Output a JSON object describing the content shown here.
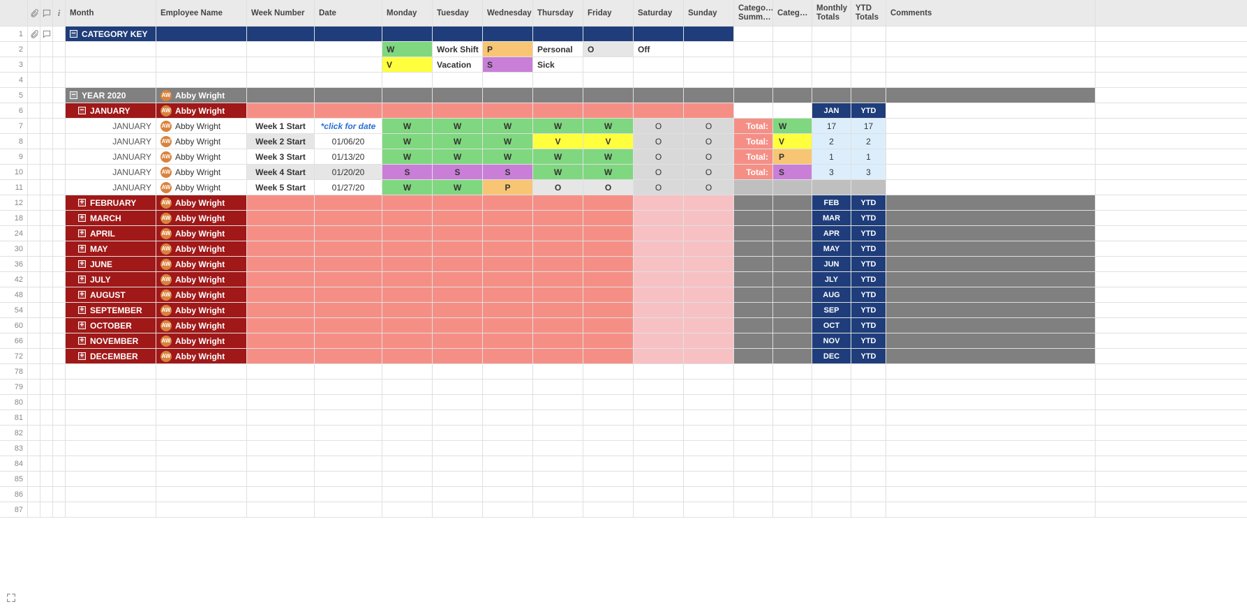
{
  "headers": {
    "month": "Month",
    "employee": "Employee Name",
    "weeknum": "Week Number",
    "date": "Date",
    "days": [
      "Monday",
      "Tuesday",
      "Wednesday",
      "Thursday",
      "Friday",
      "Saturday",
      "Sunday"
    ],
    "catsum": "Catego… Summ…",
    "cat": "Categ…",
    "monthtot": "Monthly Totals",
    "ytdtot": "YTD Totals",
    "comments": "Comments"
  },
  "categoryKey": {
    "title": "CATEGORY KEY",
    "rows": [
      [
        {
          "code": "W",
          "bg": "green"
        },
        {
          "label": "Work Shift"
        },
        {
          "code": "P",
          "bg": "orange"
        },
        {
          "label": "Personal"
        },
        {
          "code": "O",
          "bg": "lightgray"
        },
        {
          "label": "Off"
        }
      ],
      [
        {
          "code": "V",
          "bg": "yellow"
        },
        {
          "label": "Vacation"
        },
        {
          "code": "S",
          "bg": "purple"
        },
        {
          "label": "Sick"
        }
      ]
    ]
  },
  "yearTitle": "YEAR 2020",
  "employee": {
    "name": "Abby Wright",
    "initials": "AW"
  },
  "january": {
    "title": "JANUARY",
    "monthCode": "JAN",
    "ytd": "YTD",
    "weeks": [
      {
        "rn": "7",
        "name": "Week 1 Start",
        "date": "*click for date",
        "dateClass": "italic-blue",
        "d": [
          {
            "v": "W",
            "bg": "green"
          },
          {
            "v": "W",
            "bg": "green"
          },
          {
            "v": "W",
            "bg": "green"
          },
          {
            "v": "W",
            "bg": "green"
          },
          {
            "v": "W",
            "bg": "green"
          },
          {
            "v": "O",
            "bg": "offgray"
          },
          {
            "v": "O",
            "bg": "offgray"
          }
        ],
        "totLbl": "Total:",
        "catCode": {
          "v": "W",
          "bg": "green"
        },
        "m": "17",
        "y": "17"
      },
      {
        "rn": "8",
        "name": "Week 2 Start",
        "nameBg": "lightgray",
        "date": "01/06/20",
        "d": [
          {
            "v": "W",
            "bg": "green"
          },
          {
            "v": "W",
            "bg": "green"
          },
          {
            "v": "W",
            "bg": "green"
          },
          {
            "v": "V",
            "bg": "yellow"
          },
          {
            "v": "V",
            "bg": "yellow"
          },
          {
            "v": "O",
            "bg": "offgray"
          },
          {
            "v": "O",
            "bg": "offgray"
          }
        ],
        "totLbl": "Total:",
        "catCode": {
          "v": "V",
          "bg": "yellow"
        },
        "m": "2",
        "y": "2"
      },
      {
        "rn": "9",
        "name": "Week 3 Start",
        "date": "01/13/20",
        "d": [
          {
            "v": "W",
            "bg": "green"
          },
          {
            "v": "W",
            "bg": "green"
          },
          {
            "v": "W",
            "bg": "green"
          },
          {
            "v": "W",
            "bg": "green"
          },
          {
            "v": "W",
            "bg": "green"
          },
          {
            "v": "O",
            "bg": "offgray"
          },
          {
            "v": "O",
            "bg": "offgray"
          }
        ],
        "totLbl": "Total:",
        "catCode": {
          "v": "P",
          "bg": "orange"
        },
        "m": "1",
        "y": "1"
      },
      {
        "rn": "10",
        "name": "Week 4 Start",
        "nameBg": "lightgray",
        "date": "01/20/20",
        "dateBg": "lightgray",
        "d": [
          {
            "v": "S",
            "bg": "purple"
          },
          {
            "v": "S",
            "bg": "purple"
          },
          {
            "v": "S",
            "bg": "purple"
          },
          {
            "v": "W",
            "bg": "green"
          },
          {
            "v": "W",
            "bg": "green"
          },
          {
            "v": "O",
            "bg": "offgray"
          },
          {
            "v": "O",
            "bg": "offgray"
          }
        ],
        "totLbl": "Total:",
        "catCode": {
          "v": "S",
          "bg": "purple"
        },
        "m": "3",
        "y": "3"
      },
      {
        "rn": "11",
        "name": "Week 5 Start",
        "date": "01/27/20",
        "d": [
          {
            "v": "W",
            "bg": "green"
          },
          {
            "v": "W",
            "bg": "green"
          },
          {
            "v": "P",
            "bg": "orange"
          },
          {
            "v": "O",
            "bg": "lightgray"
          },
          {
            "v": "O",
            "bg": "lightgray"
          },
          {
            "v": "O",
            "bg": "offgray"
          },
          {
            "v": "O",
            "bg": "offgray"
          }
        ],
        "totLbl": "",
        "catBg": "ctrlgray",
        "mBg": "ctrlgray",
        "yBg": "ctrlgray"
      }
    ]
  },
  "otherMonths": [
    {
      "rn": "12",
      "title": "FEBRUARY",
      "code": "FEB"
    },
    {
      "rn": "18",
      "title": "MARCH",
      "code": "MAR"
    },
    {
      "rn": "24",
      "title": "APRIL",
      "code": "APR"
    },
    {
      "rn": "30",
      "title": "MAY",
      "code": "MAY"
    },
    {
      "rn": "36",
      "title": "JUNE",
      "code": "JUN"
    },
    {
      "rn": "42",
      "title": "JULY",
      "code": "JLY"
    },
    {
      "rn": "48",
      "title": "AUGUST",
      "code": "AUG"
    },
    {
      "rn": "54",
      "title": "SEPTEMBER",
      "code": "SEP"
    },
    {
      "rn": "60",
      "title": "OCTOBER",
      "code": "OCT"
    },
    {
      "rn": "66",
      "title": "NOVEMBER",
      "code": "NOV"
    },
    {
      "rn": "72",
      "title": "DECEMBER",
      "code": "DEC"
    }
  ],
  "ytdLabel": "YTD",
  "emptyRows": [
    "78",
    "79",
    "80",
    "81",
    "82",
    "83",
    "84",
    "85",
    "86",
    "87"
  ],
  "janLabel": "JANUARY"
}
